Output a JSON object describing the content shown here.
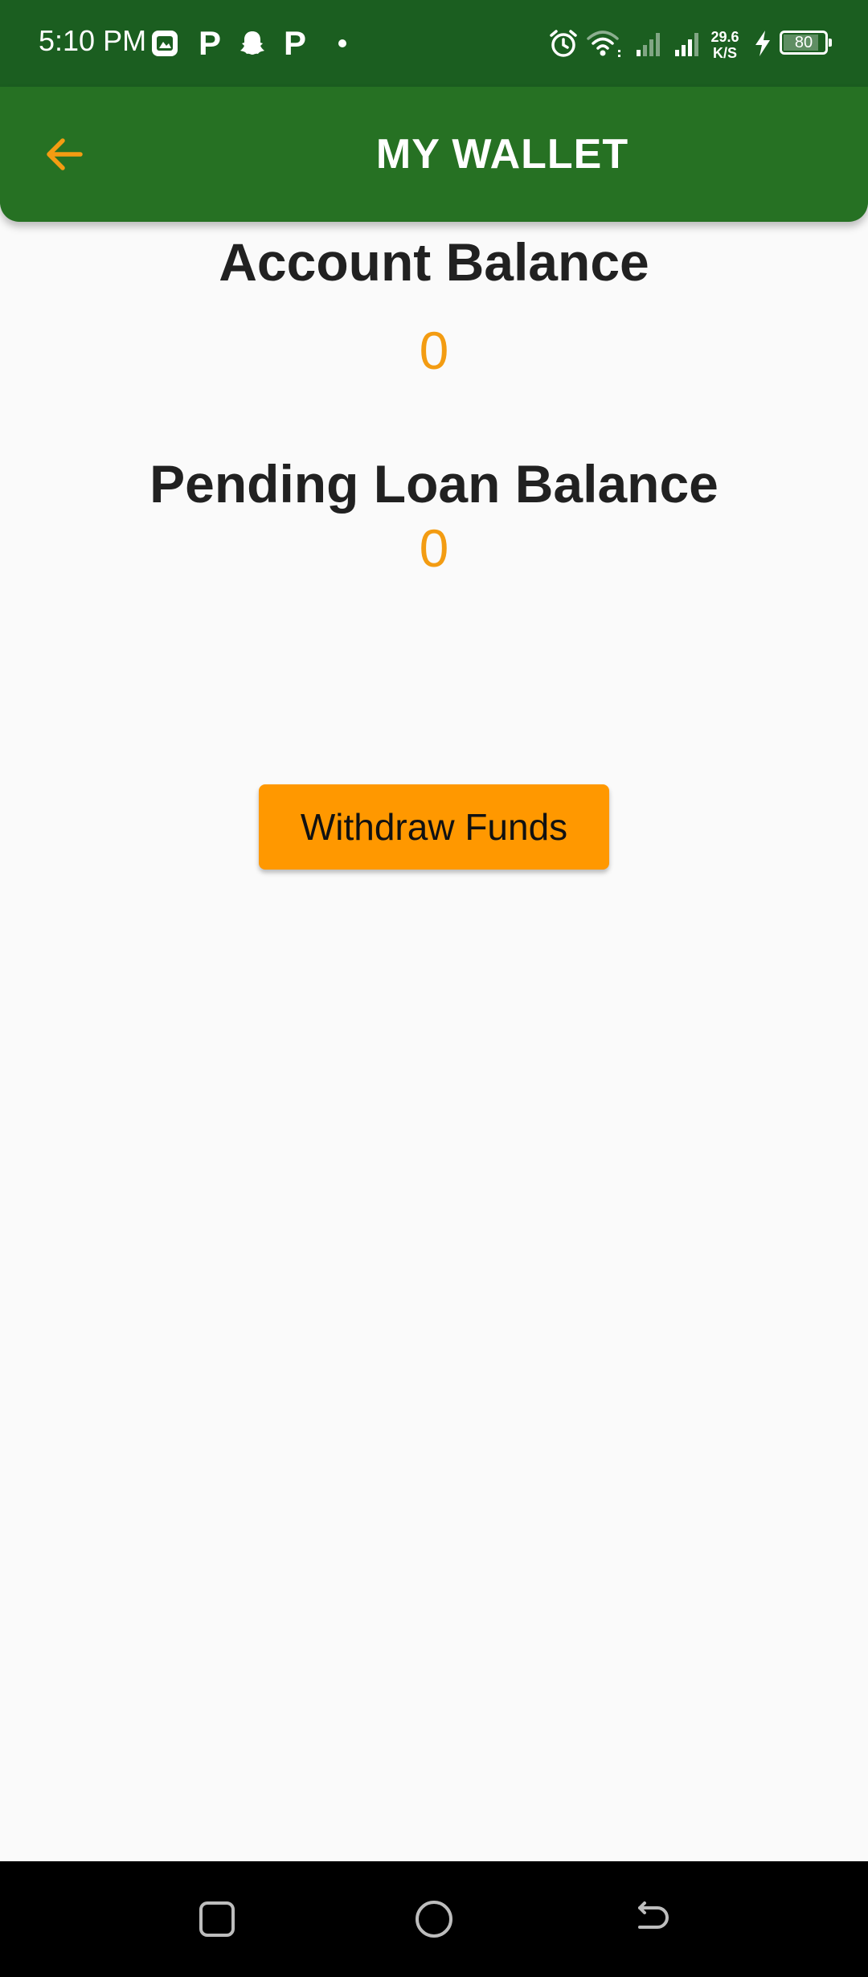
{
  "status_bar": {
    "time": "5:10 PM",
    "icons": [
      "gallery-icon",
      "p-app-icon",
      "snapchat-icon",
      "p-app-icon",
      "dot-icon",
      "alarm-icon",
      "wifi-icon",
      "signal-weak-icon",
      "signal-icon",
      "charging-icon"
    ],
    "p_icon_text": "P",
    "net_speed_value": "29.6",
    "net_speed_unit": "K/S",
    "battery_level": "80"
  },
  "app_bar": {
    "title": "MY WALLET",
    "back_icon": "arrow-back-icon",
    "accent_color": "#F39C12",
    "background_color": "#267123"
  },
  "account_balance": {
    "label": "Account Balance",
    "value": "0"
  },
  "pending_loan_balance": {
    "label": "Pending Loan Balance",
    "value": "0"
  },
  "actions": {
    "withdraw_label": "Withdraw Funds",
    "button_color": "#FF9800"
  },
  "nav_bar": {
    "icons": [
      "recents-icon",
      "home-icon",
      "back-icon"
    ]
  }
}
